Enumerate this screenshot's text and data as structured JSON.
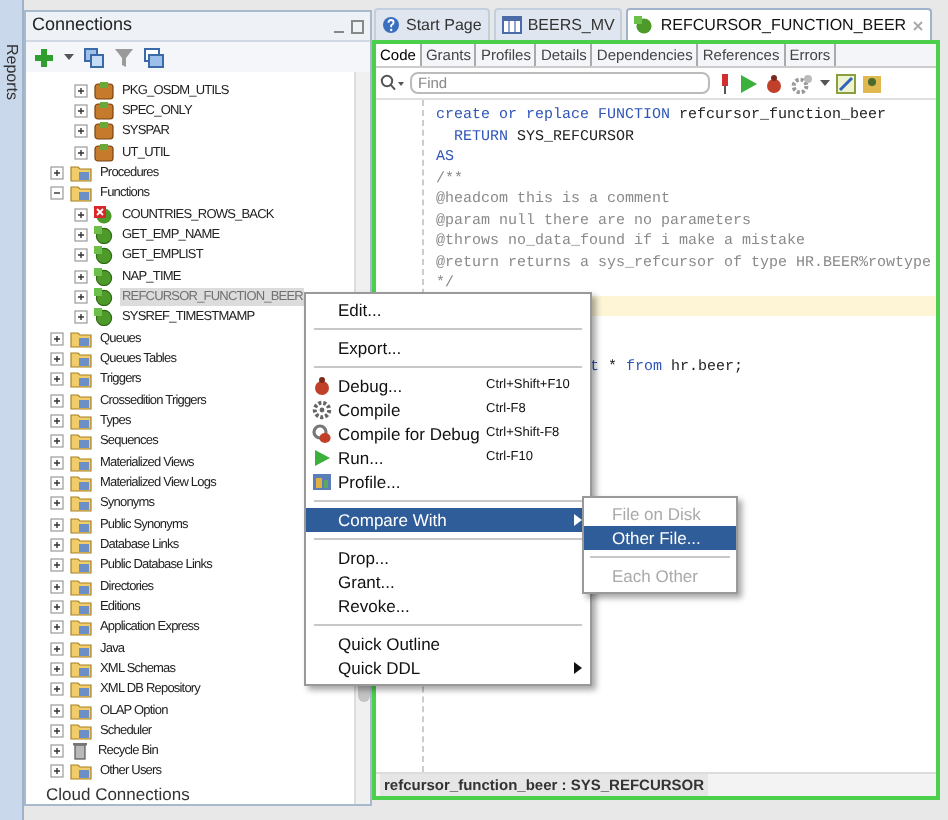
{
  "side_tab": {
    "label": "Reports"
  },
  "connections": {
    "title": "Connections",
    "clipped_group_items": [
      {
        "label": "PKG_OSDM_UTILS",
        "kind": "package",
        "expanded": false,
        "selected": false
      },
      {
        "label": "SPEC_ONLY",
        "kind": "package",
        "expanded": false,
        "selected": false
      },
      {
        "label": "SYSPAR",
        "kind": "package",
        "expanded": false,
        "selected": false
      },
      {
        "label": "UT_UTIL",
        "kind": "package",
        "expanded": false,
        "selected": false
      }
    ],
    "items": [
      {
        "label": "Procedures",
        "kind": "folder",
        "expanded": false,
        "selected": false
      },
      {
        "label": "Functions",
        "kind": "folder",
        "expanded": true,
        "selected": false,
        "children": [
          {
            "label": "COUNTRIES_ROWS_BACK",
            "kind": "invalid_function",
            "expanded": false,
            "selected": false
          },
          {
            "label": "GET_EMP_NAME",
            "kind": "function",
            "expanded": false,
            "selected": false
          },
          {
            "label": "GET_EMPLIST",
            "kind": "function",
            "expanded": false,
            "selected": false
          },
          {
            "label": "NAP_TIME",
            "kind": "function",
            "expanded": false,
            "selected": false
          },
          {
            "label": "REFCURSOR_FUNCTION_BEER",
            "kind": "function",
            "expanded": false,
            "selected": true
          },
          {
            "label": "SYSREF_TIMESTMAMP",
            "kind": "function",
            "expanded": false,
            "selected": false
          }
        ]
      },
      {
        "label": "Queues",
        "kind": "folder",
        "expanded": false,
        "selected": false
      },
      {
        "label": "Queues Tables",
        "kind": "folder",
        "expanded": false,
        "selected": false
      },
      {
        "label": "Triggers",
        "kind": "folder",
        "expanded": false,
        "selected": false
      },
      {
        "label": "Crossedition Triggers",
        "kind": "folder",
        "expanded": false,
        "selected": false
      },
      {
        "label": "Types",
        "kind": "folder",
        "expanded": false,
        "selected": false
      },
      {
        "label": "Sequences",
        "kind": "folder",
        "expanded": false,
        "selected": false
      },
      {
        "label": "Materialized Views",
        "kind": "folder",
        "expanded": false,
        "selected": false
      },
      {
        "label": "Materialized View Logs",
        "kind": "folder",
        "expanded": false,
        "selected": false
      },
      {
        "label": "Synonyms",
        "kind": "folder",
        "expanded": false,
        "selected": false
      },
      {
        "label": "Public Synonyms",
        "kind": "folder",
        "expanded": false,
        "selected": false
      },
      {
        "label": "Database Links",
        "kind": "folder",
        "expanded": false,
        "selected": false
      },
      {
        "label": "Public Database Links",
        "kind": "folder",
        "expanded": false,
        "selected": false
      },
      {
        "label": "Directories",
        "kind": "folder",
        "expanded": false,
        "selected": false
      },
      {
        "label": "Editions",
        "kind": "folder",
        "expanded": false,
        "selected": false
      },
      {
        "label": "Application Express",
        "kind": "folder",
        "expanded": false,
        "selected": false
      },
      {
        "label": "Java",
        "kind": "folder",
        "expanded": false,
        "selected": false
      },
      {
        "label": "XML Schemas",
        "kind": "folder",
        "expanded": false,
        "selected": false
      },
      {
        "label": "XML DB Repository",
        "kind": "folder",
        "expanded": false,
        "selected": false
      },
      {
        "label": "OLAP Option",
        "kind": "folder",
        "expanded": false,
        "selected": false
      },
      {
        "label": "Scheduler",
        "kind": "folder",
        "expanded": false,
        "selected": false
      },
      {
        "label": "Recycle Bin",
        "kind": "bin",
        "expanded": false,
        "selected": false
      },
      {
        "label": "Other Users",
        "kind": "folder",
        "expanded": false,
        "selected": false
      }
    ],
    "footer": "Cloud Connections"
  },
  "editor_tabs": [
    {
      "label": "Start Page",
      "kind": "help",
      "selected": false
    },
    {
      "label": "BEERS_MV",
      "kind": "table",
      "selected": false
    },
    {
      "label": "REFCURSOR_FUNCTION_BEER",
      "kind": "function",
      "selected": true
    }
  ],
  "sub_tabs": [
    {
      "label": "Code",
      "selected": true
    },
    {
      "label": "Grants",
      "selected": false
    },
    {
      "label": "Profiles",
      "selected": false
    },
    {
      "label": "Details",
      "selected": false
    },
    {
      "label": "Dependencies",
      "selected": false
    },
    {
      "label": "References",
      "selected": false
    },
    {
      "label": "Errors",
      "selected": false
    }
  ],
  "find": {
    "placeholder": "Find"
  },
  "code_lines": [
    {
      "kind": "full",
      "current": false,
      "segments": [
        {
          "text": "create or replace FUNCTION",
          "kind": "keyword"
        },
        {
          "text": " refcursor_function_beer",
          "kind": "plain"
        }
      ]
    },
    {
      "kind": "full",
      "current": false,
      "segments": [
        {
          "text": "  RETURN",
          "kind": "keyword"
        },
        {
          "text": " SYS_REFCURSOR",
          "kind": "plain"
        }
      ]
    },
    {
      "kind": "full",
      "current": false,
      "segments": [
        {
          "text": "AS",
          "kind": "keyword"
        }
      ]
    },
    {
      "kind": "full",
      "current": false,
      "segments": [
        {
          "text": "/**",
          "kind": "comment"
        }
      ]
    },
    {
      "kind": "full",
      "current": false,
      "segments": [
        {
          "text": "@headcom this is a comment",
          "kind": "comment"
        }
      ]
    },
    {
      "kind": "full",
      "current": false,
      "segments": [
        {
          "text": "@param null there are no parameters",
          "kind": "comment"
        }
      ]
    },
    {
      "kind": "full",
      "current": false,
      "segments": [
        {
          "text": "@throws no_data_found if i make a mistake",
          "kind": "comment"
        }
      ]
    },
    {
      "kind": "full",
      "current": false,
      "segments": [
        {
          "text": "@return returns a sys_refcursor of type HR.BEER%rowtype",
          "kind": "comment"
        }
      ]
    },
    {
      "kind": "full",
      "current": false,
      "segments": [
        {
          "text": "*/",
          "kind": "comment"
        }
      ]
    },
    {
      "current": true
    },
    {
      "current": false
    },
    {
      "current": false
    },
    {
      "kind": "covered",
      "current": false,
      "segments": [
        {
          "text": "t",
          "kind": "keyword"
        },
        {
          "text": " * ",
          "kind": "plain"
        },
        {
          "text": "from",
          "kind": "keyword"
        },
        {
          "text": " hr.beer;",
          "kind": "plain"
        }
      ]
    }
  ],
  "breadcrumb": "refcursor_function_beer : SYS_REFCURSOR",
  "context_menu": {
    "items": [
      {
        "kind": "plain",
        "label": "Edit...",
        "selected": false
      },
      {
        "kind": "separator"
      },
      {
        "kind": "plain",
        "label": "Export...",
        "selected": false
      },
      {
        "kind": "separator"
      },
      {
        "kind": "debug",
        "label": "Debug...",
        "shortcut": "Ctrl+Shift+F10",
        "selected": false
      },
      {
        "kind": "compile",
        "label": "Compile",
        "shortcut": "Ctrl-F8",
        "selected": false
      },
      {
        "kind": "compile_debug",
        "label": "Compile for Debug",
        "shortcut": "Ctrl+Shift-F8",
        "selected": false
      },
      {
        "kind": "run",
        "label": "Run...",
        "shortcut": "Ctrl-F10",
        "selected": false
      },
      {
        "kind": "profile",
        "label": "Profile...",
        "selected": false
      },
      {
        "kind": "separator"
      },
      {
        "kind": "submenu",
        "label": "Compare With",
        "selected": true
      },
      {
        "kind": "separator"
      },
      {
        "kind": "plain",
        "label": "Drop...",
        "selected": false
      },
      {
        "kind": "plain",
        "label": "Grant...",
        "selected": false
      },
      {
        "kind": "plain",
        "label": "Revoke...",
        "selected": false
      },
      {
        "kind": "separator"
      },
      {
        "kind": "plain",
        "label": "Quick Outline",
        "selected": false
      },
      {
        "kind": "submenu",
        "label": "Quick DDL",
        "selected": false
      }
    ]
  },
  "submenu": {
    "items": [
      {
        "kind": "item",
        "label": "File on Disk",
        "disabled": true,
        "selected": false
      },
      {
        "kind": "item",
        "label": "Other File...",
        "disabled": false,
        "selected": true
      },
      {
        "kind": "separator"
      },
      {
        "kind": "item",
        "label": "Each Other",
        "disabled": true,
        "selected": false
      }
    ]
  }
}
